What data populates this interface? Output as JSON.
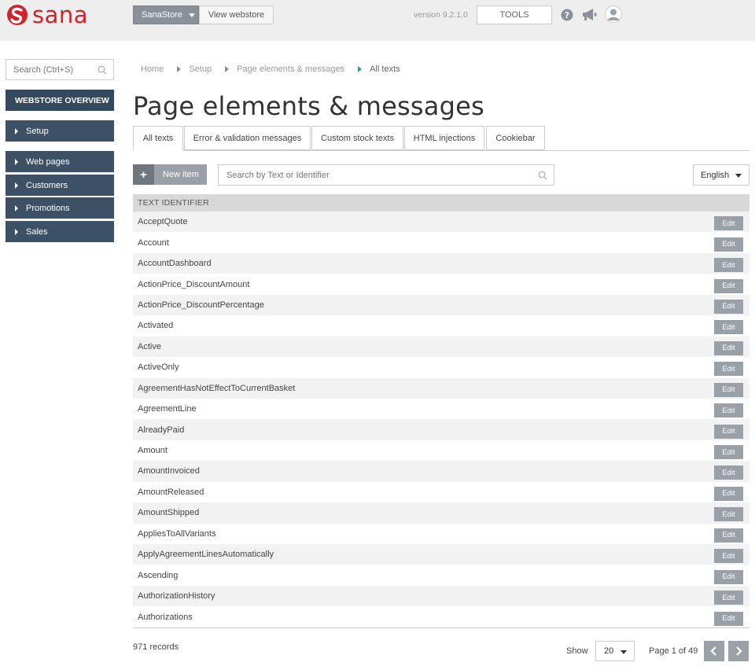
{
  "header": {
    "logo_text": "sana",
    "store_button": "SanaStore",
    "view_webstore": "View webstore",
    "version": "version 9.2.1.0",
    "tools": "TOOLS",
    "icons": [
      "help-icon",
      "megaphone-icon",
      "user-avatar-icon"
    ]
  },
  "sidebar": {
    "search_placeholder": "Search (Ctrl+S)",
    "overview": "WEBSTORE OVERVIEW",
    "items": [
      {
        "label": "Setup"
      },
      {
        "label": "Web pages"
      },
      {
        "label": "Customers"
      },
      {
        "label": "Promotions"
      },
      {
        "label": "Sales"
      }
    ]
  },
  "breadcrumb": [
    "Home",
    "Setup",
    "Page elements & messages",
    "All texts"
  ],
  "page": {
    "title": "Page elements & messages"
  },
  "tabs": [
    {
      "label": "All texts",
      "active": true
    },
    {
      "label": "Error & validation messages",
      "active": false
    },
    {
      "label": "Custom stock texts",
      "active": false
    },
    {
      "label": "HTML injections",
      "active": false
    },
    {
      "label": "Cookiebar",
      "active": false
    }
  ],
  "toolbar": {
    "new_item": "New item",
    "search_placeholder": "Search by Text or Identifier",
    "language": "English"
  },
  "table": {
    "header": "TEXT IDENTIFIER",
    "edit_label": "Edit",
    "rows": [
      "AcceptQuote",
      "Account",
      "AccountDashboard",
      "ActionPrice_DiscountAmount",
      "ActionPrice_DiscountPercentage",
      "Activated",
      "Active",
      "ActiveOnly",
      "AgreementHasNotEffectToCurrentBasket",
      "AgreementLine",
      "AlreadyPaid",
      "Amount",
      "AmountInvoiced",
      "AmountReleased",
      "AmountShipped",
      "AppliesToAllVariants",
      "ApplyAgreementLinesAutomatically",
      "Ascending",
      "AuthorizationHistory",
      "Authorizations"
    ]
  },
  "footer": {
    "records": "971 records",
    "show_label": "Show",
    "page_size": "20",
    "page_info": "Page 1 of 49"
  },
  "colors": {
    "brand": "#d2232a",
    "nav": "#3d5166",
    "button_gray": "#9aa0a8"
  }
}
